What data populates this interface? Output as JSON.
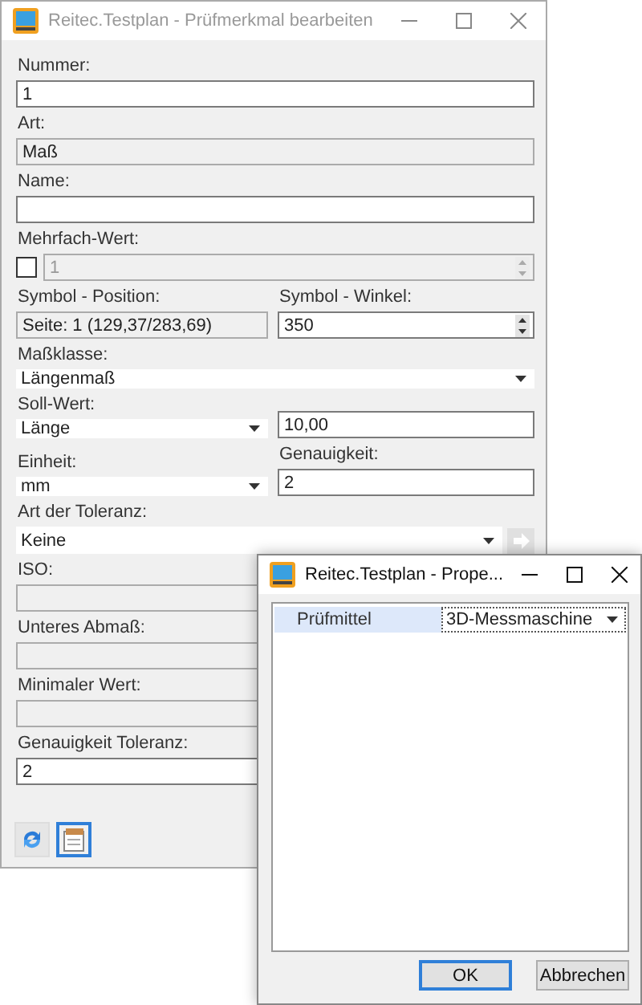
{
  "main_window": {
    "title": "Reitec.Testplan - Prüfmerkmal bearbeiten",
    "active": false,
    "rows": [
      {
        "cells": [
          {
            "label": "Nummer:",
            "kind": "text",
            "value": "1"
          }
        ]
      },
      {
        "cells": [
          {
            "label": "Art:",
            "kind": "readonly",
            "value": "Maß"
          }
        ]
      },
      {
        "cells": [
          {
            "label": "Name:",
            "kind": "text"
          }
        ]
      },
      {
        "cells": [
          {
            "label": "Mehrfach-Wert:",
            "kind": "checkspin",
            "checked": false,
            "disabled": true,
            "value": "1"
          }
        ]
      },
      {
        "cells": [
          {
            "label": "Symbol - Position:",
            "kind": "readonly",
            "value": "Seite: 1 (129,37/283,69)"
          },
          {
            "label": "Symbol - Winkel:",
            "kind": "spin",
            "value": "350"
          }
        ]
      },
      {
        "cells": [
          {
            "label": "Maßklasse:",
            "kind": "dropdown",
            "value": "Längenmaß"
          }
        ]
      },
      {
        "cells": [
          {
            "label": "Soll-Wert:",
            "kind": "dropdown",
            "value": "Länge"
          },
          {
            "kind": "text",
            "value": "10,00"
          }
        ]
      },
      {
        "cells": [
          {
            "label": "Einheit:",
            "kind": "dropdown",
            "value": "mm"
          },
          {
            "label": "Genauigkeit:",
            "kind": "text",
            "value": "2"
          }
        ]
      },
      {
        "cells": [
          {
            "label": "Art der Toleranz:",
            "kind": "dropdown_button",
            "value": "Keine"
          }
        ]
      },
      {
        "cells": [
          {
            "label": "ISO:",
            "kind": "readonly"
          }
        ]
      },
      {
        "cells": [
          {
            "label": "Unteres Abmaß:",
            "kind": "readonly"
          }
        ]
      },
      {
        "cells": [
          {
            "label": "Minimaler Wert:",
            "kind": "readonly"
          }
        ]
      },
      {
        "cells": [
          {
            "label": "Genauigkeit Toleranz:",
            "kind": "text",
            "value": "2"
          }
        ]
      }
    ],
    "toolbar": [
      {
        "kind": "refresh",
        "selected": false
      },
      {
        "kind": "notepad",
        "selected": true
      }
    ]
  },
  "dialog": {
    "title": "Reitec.Testplan - Prope...",
    "active": true,
    "properties": [
      {
        "name": "Prüfmittel",
        "value": "3D-Messmaschine",
        "selected": true
      }
    ],
    "buttons": [
      {
        "label": "OK",
        "default": true
      },
      {
        "label": "Abbrechen",
        "default": false
      }
    ]
  }
}
